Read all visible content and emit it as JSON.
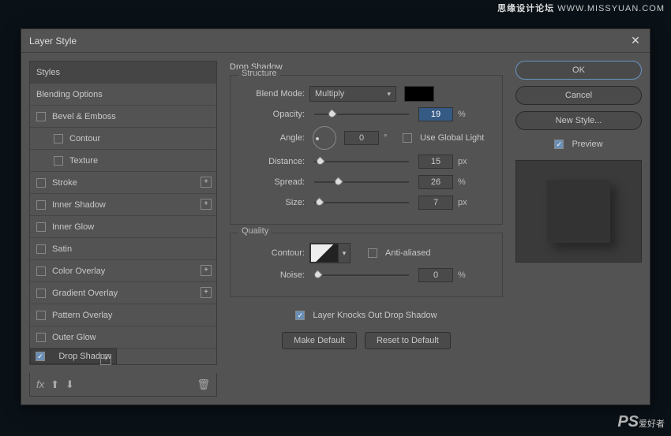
{
  "watermark_top_cn": "思缘设计论坛",
  "watermark_top_url": "WWW.MISSYUAN.COM",
  "watermark_br_ps": "PS",
  "watermark_br_cn": "爱好者",
  "dialog": {
    "title": "Layer Style"
  },
  "left": {
    "styles": "Styles",
    "blending": "Blending Options",
    "bevel": "Bevel & Emboss",
    "contour": "Contour",
    "texture": "Texture",
    "stroke": "Stroke",
    "innerShadow": "Inner Shadow",
    "innerGlow": "Inner Glow",
    "satin": "Satin",
    "colorOverlay": "Color Overlay",
    "gradientOverlay": "Gradient Overlay",
    "patternOverlay": "Pattern Overlay",
    "outerGlow": "Outer Glow",
    "dropShadow": "Drop Shadow",
    "fx": "fx"
  },
  "panel": {
    "title": "Drop Shadow",
    "structure": "Structure",
    "blendMode": {
      "label": "Blend Mode:",
      "value": "Multiply"
    },
    "opacity": {
      "label": "Opacity:",
      "value": "19",
      "unit": "%"
    },
    "angle": {
      "label": "Angle:",
      "value": "0",
      "degree": "°",
      "global": "Use Global Light"
    },
    "distance": {
      "label": "Distance:",
      "value": "15",
      "unit": "px"
    },
    "spread": {
      "label": "Spread:",
      "value": "26",
      "unit": "%"
    },
    "size": {
      "label": "Size:",
      "value": "7",
      "unit": "px"
    },
    "quality": "Quality",
    "contour": {
      "label": "Contour:",
      "aa": "Anti-aliased"
    },
    "noise": {
      "label": "Noise:",
      "value": "0",
      "unit": "%"
    },
    "knockout": "Layer Knocks Out Drop Shadow",
    "makeDefault": "Make Default",
    "resetDefault": "Reset to Default"
  },
  "right": {
    "ok": "OK",
    "cancel": "Cancel",
    "newStyle": "New Style...",
    "preview": "Preview"
  }
}
